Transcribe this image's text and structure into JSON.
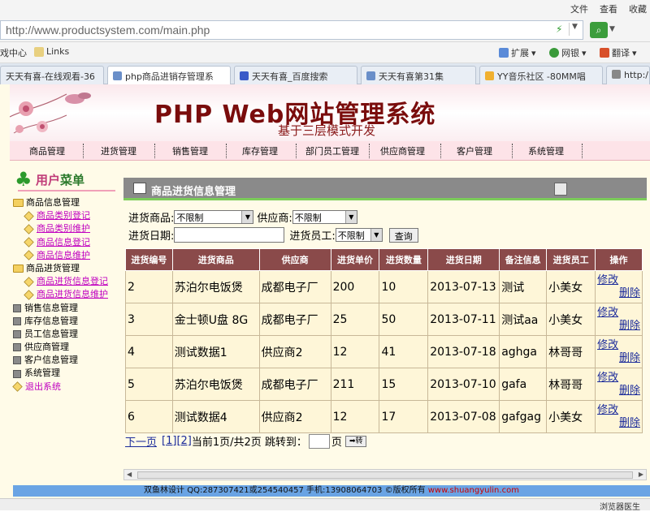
{
  "browser": {
    "menus": [
      "文件",
      "查看",
      "收藏"
    ],
    "address": "http://www.productsystem.com/main.php",
    "favorites": [
      "戏中心",
      "Links"
    ],
    "toolbar": [
      "扩展",
      "网银",
      "翻译"
    ],
    "tabs": [
      "天天有喜-在线观看-36",
      "php商品进销存管理系",
      "天天有喜_百度搜索",
      "天天有喜第31集",
      "YY音乐社区 -80MM唱",
      "http:/"
    ],
    "status": "浏览器医生"
  },
  "banner": {
    "title": "PHP Web网站管理系统",
    "subtitle": "基于三层模式开发"
  },
  "nav": [
    "商品管理",
    "进货管理",
    "销售管理",
    "库存管理",
    "部门员工管理",
    "供应商管理",
    "客户管理",
    "系统管理"
  ],
  "sidebar": {
    "title_a": "用户",
    "title_b": "菜单",
    "items": [
      {
        "label": "商品信息管理",
        "kind": "folder"
      },
      {
        "label": "商品类别登记",
        "kind": "sub"
      },
      {
        "label": "商品类别维护",
        "kind": "sub"
      },
      {
        "label": "商品信息登记",
        "kind": "sub"
      },
      {
        "label": "商品信息维护",
        "kind": "sub"
      },
      {
        "label": "商品进货管理",
        "kind": "folder"
      },
      {
        "label": "商品进货信息登记",
        "kind": "sub"
      },
      {
        "label": "商品进货信息维护",
        "kind": "sub"
      },
      {
        "label": "销售信息管理",
        "kind": "square"
      },
      {
        "label": "库存信息管理",
        "kind": "square"
      },
      {
        "label": "员工信息管理",
        "kind": "square"
      },
      {
        "label": "供应商管理",
        "kind": "square"
      },
      {
        "label": "客户信息管理",
        "kind": "square"
      },
      {
        "label": "系统管理",
        "kind": "square"
      },
      {
        "label": "退出系统",
        "kind": "exit"
      }
    ]
  },
  "main": {
    "title": "商品进货信息管理",
    "filter": {
      "product_label": "进货商品:",
      "product_value": "不限制",
      "supplier_label": "供应商:",
      "supplier_value": "不限制",
      "date_label": "进货日期:",
      "staff_label": "进货员工:",
      "staff_value": "不限制",
      "query_button": "查询"
    },
    "columns": [
      "进货编号",
      "进货商品",
      "供应商",
      "进货单价",
      "进货数量",
      "进货日期",
      "备注信息",
      "进货员工",
      "操作"
    ],
    "rows": [
      [
        "2",
        "苏泊尔电饭煲",
        "成都电子厂",
        "200",
        "10",
        "2013-07-13",
        "测试",
        "小美女"
      ],
      [
        "3",
        "金士顿U盘 8G",
        "成都电子厂",
        "25",
        "50",
        "2013-07-11",
        "测试aa",
        "小美女"
      ],
      [
        "4",
        "测试数据1",
        "供应商2",
        "12",
        "41",
        "2013-07-18",
        "aghga",
        "林哥哥"
      ],
      [
        "5",
        "苏泊尔电饭煲",
        "成都电子厂",
        "211",
        "15",
        "2013-07-10",
        "gafa",
        "林哥哥"
      ],
      [
        "6",
        "测试数据4",
        "供应商2",
        "12",
        "17",
        "2013-07-08",
        "gafgag",
        "小美女"
      ]
    ],
    "edit_label": "修改",
    "delete_label": "删除",
    "pager": {
      "next": "下一页",
      "page1": "[1]",
      "page2": "[2]",
      "info": "当前1页/共2页 跳转到：",
      "page_unit": "页",
      "go": "➡转"
    }
  },
  "footer": {
    "text": "双鱼林设计 QQ:287307421或254540457 手机:13908064703 ©版权所有 ",
    "site": "www.shuangyulin.com"
  }
}
